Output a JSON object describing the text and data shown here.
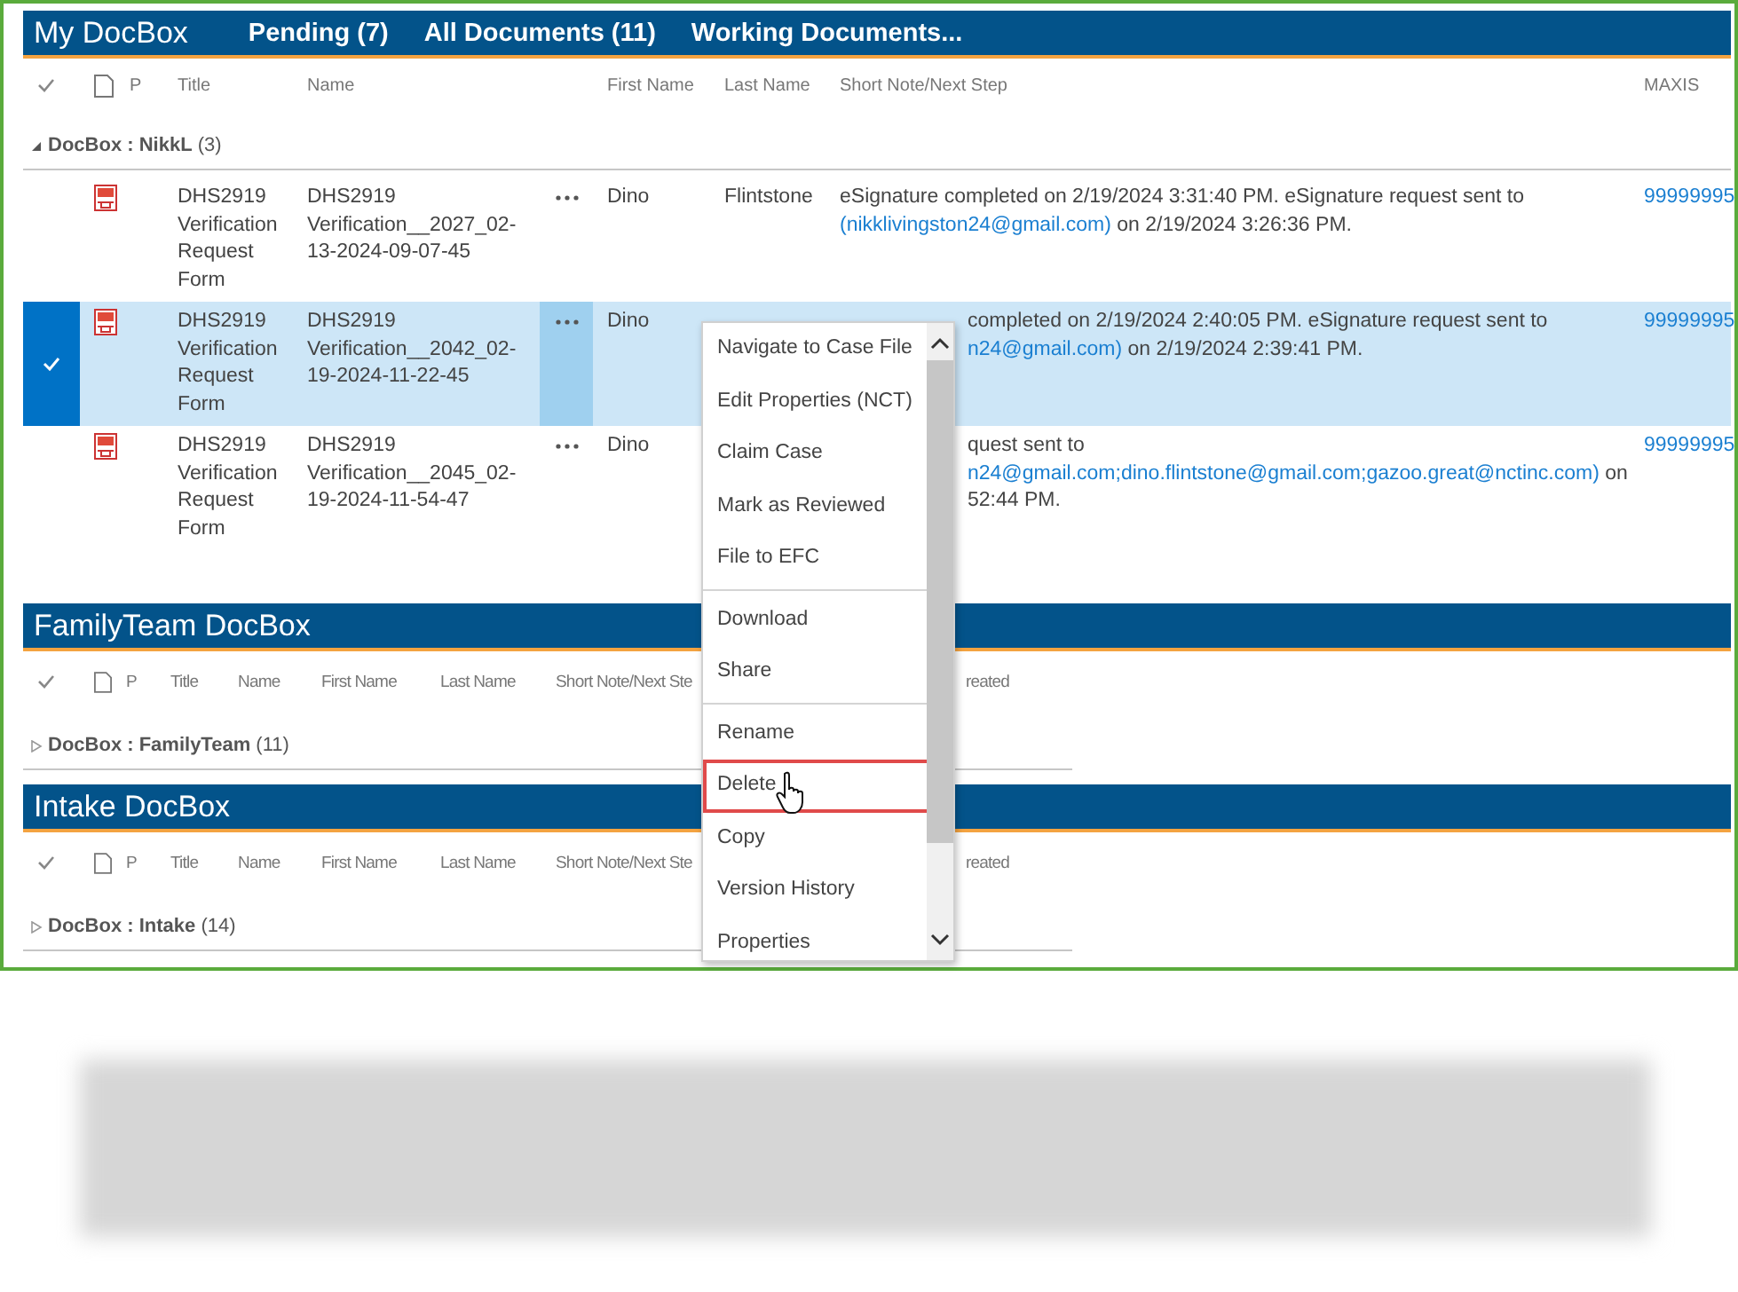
{
  "sections": [
    {
      "title": "My DocBox",
      "tabs": [
        "Pending (7)",
        "All Documents (11)",
        "Working Documents..."
      ],
      "columns": [
        {
          "kind": "check-icon"
        },
        {
          "kind": "doc-icon"
        },
        {
          "kind": "text",
          "label": "P"
        },
        {
          "kind": "text",
          "label": "Title"
        },
        {
          "kind": "text",
          "label": "Name"
        },
        {
          "kind": "blank"
        },
        {
          "kind": "text",
          "label": "First Name"
        },
        {
          "kind": "text",
          "label": "Last Name"
        },
        {
          "kind": "text",
          "label": "Short Note/Next Step"
        },
        {
          "kind": "text",
          "label": "MAXIS"
        }
      ],
      "group": {
        "label": "**DocBox : NikkL** (3)",
        "expanded": true
      },
      "rows": [
        {
          "selected": false,
          "title": "DHS2919 Verification Request Form",
          "name": "DHS2919 Verification__2027_02-13-2024-09-07-45",
          "first": "Dino",
          "last": "Flintstone",
          "note_partly_hidden": false,
          "note": [
            [
              {
                "kind": "text",
                "text": "eSignature completed on 2/19/2024 3:31:40 PM. eSignature request sent to"
              }
            ],
            [
              {
                "kind": "link",
                "text": "(nikklivingston24@gmail.com)"
              },
              {
                "kind": "text",
                "text": " on 2/19/2024 3:26:36 PM."
              }
            ]
          ],
          "maxis": "99999995"
        },
        {
          "selected": true,
          "title": "DHS2919 Verification Request Form",
          "name": "DHS2919 Verification__2042_02-19-2024-11-22-45",
          "first": "Dino",
          "note_partly_hidden": true,
          "note": [
            [
              {
                "kind": "text",
                "text": "completed on 2/19/2024 2:40:05 PM. eSignature request sent to"
              }
            ],
            [
              {
                "kind": "link",
                "text": "n24@gmail.com)"
              },
              {
                "kind": "text",
                "text": " on 2/19/2024 2:39:41 PM."
              }
            ]
          ],
          "maxis": "99999995"
        },
        {
          "selected": false,
          "title": "DHS2919 Verification Request Form",
          "name": "DHS2919 Verification__2045_02-19-2024-11-54-47",
          "first": "Dino",
          "note_partly_hidden": true,
          "note": [
            [
              {
                "kind": "text",
                "text": "quest sent to"
              }
            ],
            [
              {
                "kind": "link",
                "text": "n24@gmail.com;dino.flintstone@gmail.com;gazoo.great@nctinc.com)"
              },
              {
                "kind": "text",
                "text": " on"
              }
            ],
            [
              {
                "kind": "text",
                "text": "52:44 PM."
              }
            ]
          ],
          "maxis": "99999995"
        }
      ]
    },
    {
      "title": "FamilyTeam DocBox",
      "columns": [
        {
          "kind": "check-icon"
        },
        {
          "kind": "doc-icon"
        },
        {
          "kind": "text",
          "label": "P"
        },
        {
          "kind": "text",
          "label": "Title"
        },
        {
          "kind": "text",
          "label": "Name"
        },
        {
          "kind": "text",
          "label": "First Name"
        },
        {
          "kind": "text",
          "label": "Last Name"
        },
        {
          "kind": "text",
          "label": "Short Note/Next Ste"
        },
        {
          "kind": "text",
          "label": "reated"
        }
      ],
      "group": {
        "label": "**DocBox : FamilyTeam** (11)",
        "expanded": false
      }
    },
    {
      "title": "Intake DocBox",
      "columns": [
        {
          "kind": "check-icon"
        },
        {
          "kind": "doc-icon"
        },
        {
          "kind": "text",
          "label": "P"
        },
        {
          "kind": "text",
          "label": "Title"
        },
        {
          "kind": "text",
          "label": "Name"
        },
        {
          "kind": "text",
          "label": "First Name"
        },
        {
          "kind": "text",
          "label": "Last Name"
        },
        {
          "kind": "text",
          "label": "Short Note/Next Ste"
        },
        {
          "kind": "text",
          "label": "reated"
        }
      ],
      "group": {
        "label": "**DocBox : Intake** (14)",
        "expanded": false
      }
    }
  ],
  "context_menu": {
    "groups": [
      [
        {
          "label": "Navigate to Case File",
          "selected": false
        },
        {
          "label": "Edit Properties (NCT)",
          "selected": false
        },
        {
          "label": "Claim Case",
          "selected": false
        },
        {
          "label": "Mark as Reviewed",
          "selected": false
        },
        {
          "label": "File to EFC",
          "selected": false
        }
      ],
      [
        {
          "label": "Download",
          "selected": false
        },
        {
          "label": "Share",
          "selected": false
        }
      ],
      [
        {
          "label": "Rename",
          "selected": false
        },
        {
          "label": "Delete",
          "selected": true
        },
        {
          "label": "Copy",
          "selected": false
        },
        {
          "label": "Version History",
          "selected": false
        },
        {
          "label": "Properties",
          "selected": false
        }
      ]
    ]
  }
}
